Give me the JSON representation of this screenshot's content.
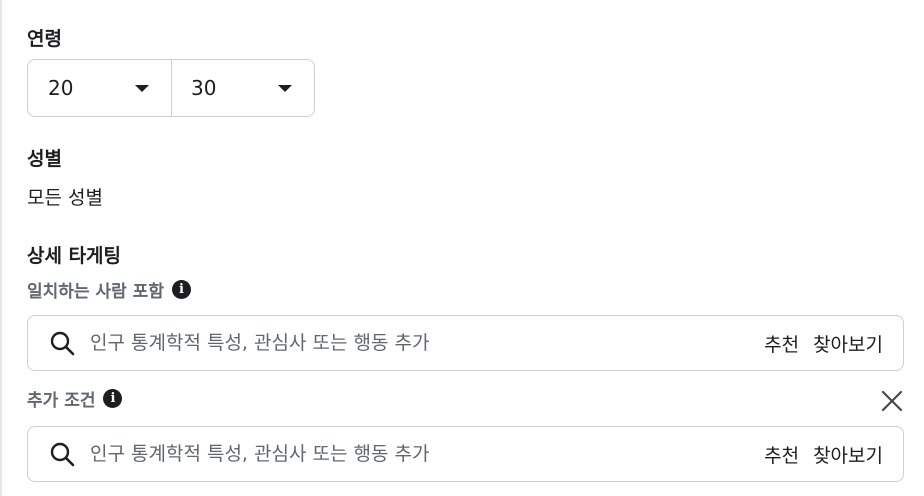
{
  "age": {
    "label": "연령",
    "min_value": "20",
    "max_value": "30"
  },
  "gender": {
    "label": "성별",
    "value": "모든 성별"
  },
  "detailed_targeting": {
    "label": "상세 타게팅",
    "include_label": "일치하는 사람 포함",
    "include_search": {
      "placeholder": "인구 통계학적 특성, 관심사 또는 행동 추가",
      "suggestions_label": "추천",
      "browse_label": "찾아보기"
    },
    "additional_label": "추가 조건",
    "additional_search": {
      "placeholder": "인구 통계학적 특성, 관심사 또는 행동 추가",
      "suggestions_label": "추천",
      "browse_label": "찾아보기"
    }
  },
  "icons": {
    "info": "i",
    "search": "search-icon",
    "close": "close-icon"
  }
}
